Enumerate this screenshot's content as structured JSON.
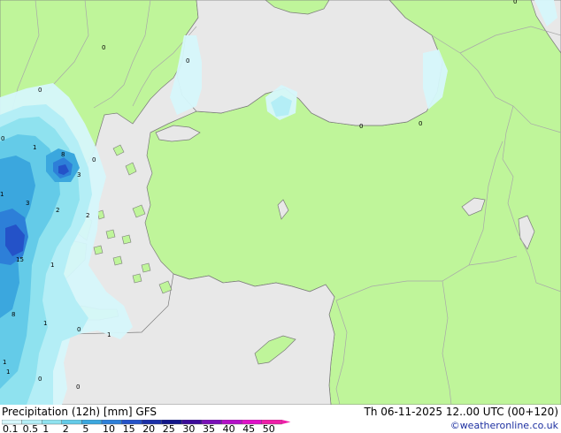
{
  "title": "Precipitation (12h) [mm] GFS",
  "datetime": "Th 06-11-2025 12..00 UTC (00+120)",
  "credit": "©weatheronline.co.uk",
  "colors": {
    "sea": "#e8e8e8",
    "land": "#bff59a",
    "border": "#a8a8a8",
    "coast": "#7a7a7a"
  },
  "legend": {
    "labels": [
      "0.1",
      "0.5",
      "1",
      "2",
      "5",
      "10",
      "15",
      "20",
      "25",
      "30",
      "35",
      "40",
      "45",
      "50"
    ],
    "colors": [
      "#d6f7fb",
      "#b4eef6",
      "#8fe2ef",
      "#64cbe8",
      "#3ba7de",
      "#2d7fd8",
      "#2452c8",
      "#1b2fa8",
      "#12168a",
      "#3b0a9a",
      "#7a0fb8",
      "#b40fc8",
      "#e010c8",
      "#f01ea8"
    ]
  },
  "values": [
    {
      "text": "0"
    },
    {
      "text": "0"
    },
    {
      "text": "0"
    },
    {
      "text": "0"
    },
    {
      "text": "0"
    },
    {
      "text": "0"
    },
    {
      "text": "1"
    },
    {
      "text": "8"
    },
    {
      "text": "0"
    },
    {
      "text": "1"
    },
    {
      "text": "3"
    },
    {
      "text": "2"
    },
    {
      "text": "2"
    },
    {
      "text": "15"
    },
    {
      "text": "1"
    },
    {
      "text": "8"
    },
    {
      "text": "1"
    },
    {
      "text": "0"
    },
    {
      "text": "1"
    },
    {
      "text": "1"
    },
    {
      "text": "0"
    },
    {
      "text": "1"
    },
    {
      "text": "0"
    },
    {
      "text": "0"
    },
    {
      "text": "3"
    }
  ]
}
